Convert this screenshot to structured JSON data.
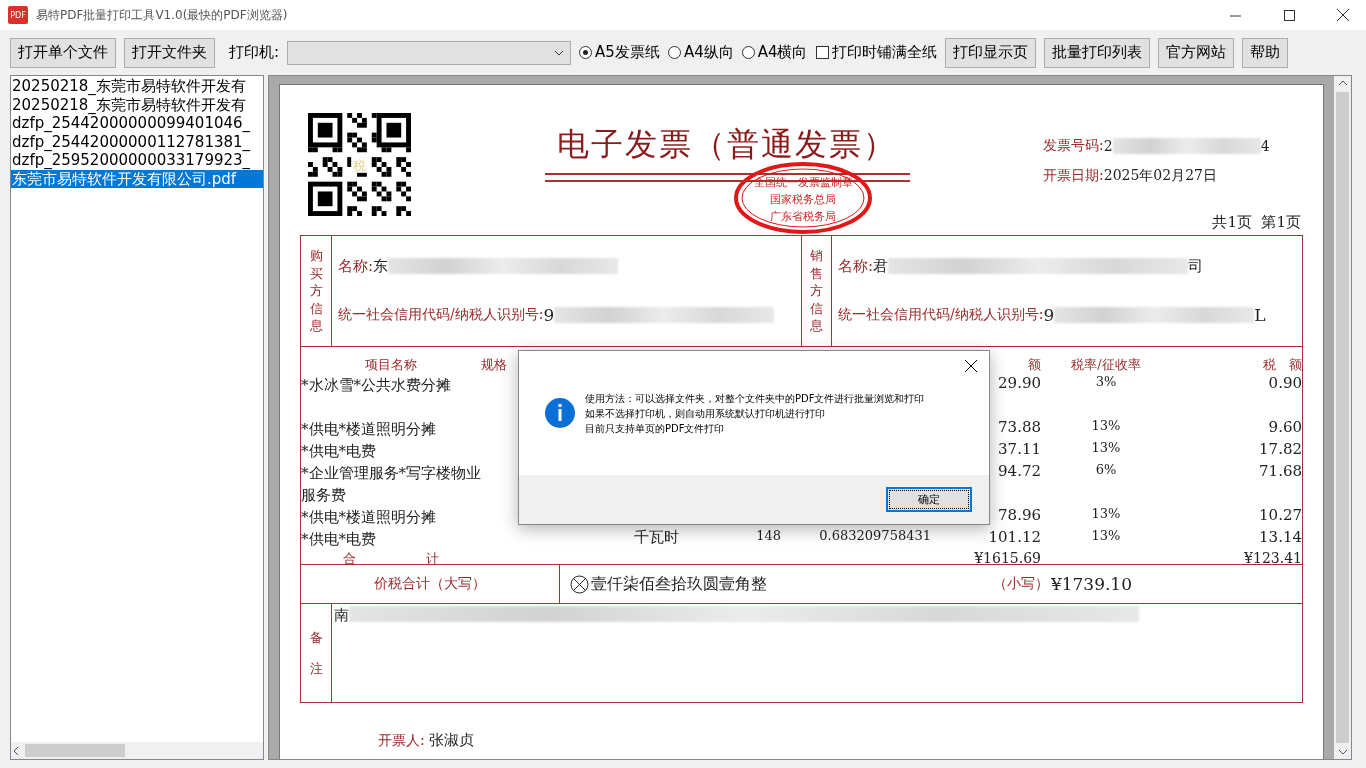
{
  "window": {
    "app_icon": "PDF",
    "title": "易特PDF批量打印工具V1.0(最快的PDF浏览器)"
  },
  "toolbar": {
    "open_buttons": [
      "打开单个文件",
      "打开文件夹"
    ],
    "printer_label": "打印机:",
    "paper_options": [
      {
        "label": "A5发票纸",
        "selected": true
      },
      {
        "label": "A4纵向",
        "selected": false
      },
      {
        "label": "A4横向",
        "selected": false
      }
    ],
    "fill_page": {
      "label": "打印时铺满全纸",
      "checked": false
    },
    "action_buttons": [
      "打印显示页",
      "批量打印列表",
      "官方网站",
      "帮助"
    ]
  },
  "file_list": [
    {
      "name": "20250218_东莞市易特软件开发有",
      "selected": false
    },
    {
      "name": "20250218_东莞市易特软件开发有",
      "selected": false
    },
    {
      "name": "dzfp_25442000000099401046_",
      "selected": false
    },
    {
      "name": "dzfp_25442000000112781381_",
      "selected": false
    },
    {
      "name": "dzfp_25952000000033179923_",
      "selected": false
    },
    {
      "name": "东莞市易特软件开发有限公司.pdf",
      "selected": true
    }
  ],
  "invoice": {
    "qr_mark": "税",
    "title": "电子发票（普通发票）",
    "stamp": {
      "top": "全国统一发票监制章",
      "middle": "国家税务总局",
      "bottom": "广东省税务局"
    },
    "number": {
      "label": "发票号码:",
      "visible_start": "2",
      "visible_end": "4"
    },
    "date": {
      "label": "开票日期:",
      "value": "2025年02月27日"
    },
    "pages": "共1页  第1页",
    "buyer": {
      "side_label": "购买方信息",
      "name_label": "名称:",
      "name_start": "东",
      "id_label": "统一社会信用代码/纳税人识别号:",
      "id_start": "9"
    },
    "seller": {
      "side_label": "销售方信息",
      "name_label": "名称:",
      "name_start": "君",
      "name_end": "司",
      "id_label": "统一社会信用代码/纳税人识别号:",
      "id_start": "9",
      "id_end": "L"
    },
    "columns": {
      "name": "项目名称",
      "spec": "规格",
      "amount": "额",
      "rate": "税率/征收率",
      "tax": "税　额"
    },
    "items": [
      {
        "name": "*水冰雪*公共水费分摊",
        "amount": "29.90",
        "rate": "3%",
        "tax": "0.90"
      },
      {
        "name": "*供电*楼道照明分摊",
        "amount": "73.88",
        "rate": "13%",
        "tax": "9.60"
      },
      {
        "name": "*供电*电费",
        "amount": "37.11",
        "rate": "13%",
        "tax": "17.82"
      },
      {
        "name": "*企业管理服务*写字楼物业服务费",
        "amount": "94.72",
        "rate": "6%",
        "tax": "71.68"
      },
      {
        "name": "*供电*楼道照明分摊",
        "amount": "78.96",
        "rate": "13%",
        "tax": "10.27"
      },
      {
        "name": "*供电*电费",
        "unit": "千瓦时",
        "quantity": "148",
        "price": "0.683209758431",
        "amount": "101.12",
        "rate": "13%",
        "tax": "13.14"
      }
    ],
    "total": {
      "label": "合计",
      "amount": "¥1615.69",
      "tax": "¥123.41"
    },
    "grand_total": {
      "label": "价税合计（大写）",
      "words": "壹仟柒佰叁拾玖圆壹角整",
      "small_label": "（小写）",
      "value": "¥1739.10"
    },
    "remarks": {
      "side_label": "备注",
      "visible_start": "南"
    },
    "issuer": {
      "label": "开票人:",
      "value": "张淑贞"
    }
  },
  "dialog": {
    "lines": [
      "使用方法：可以选择文件夹，对整个文件夹中的PDF文件进行批量浏览和打印",
      "如果不选择打印机，则自动用系统默认打印机进行打印",
      "目前只支持单页的PDF文件打印"
    ],
    "ok_button": "确定"
  }
}
